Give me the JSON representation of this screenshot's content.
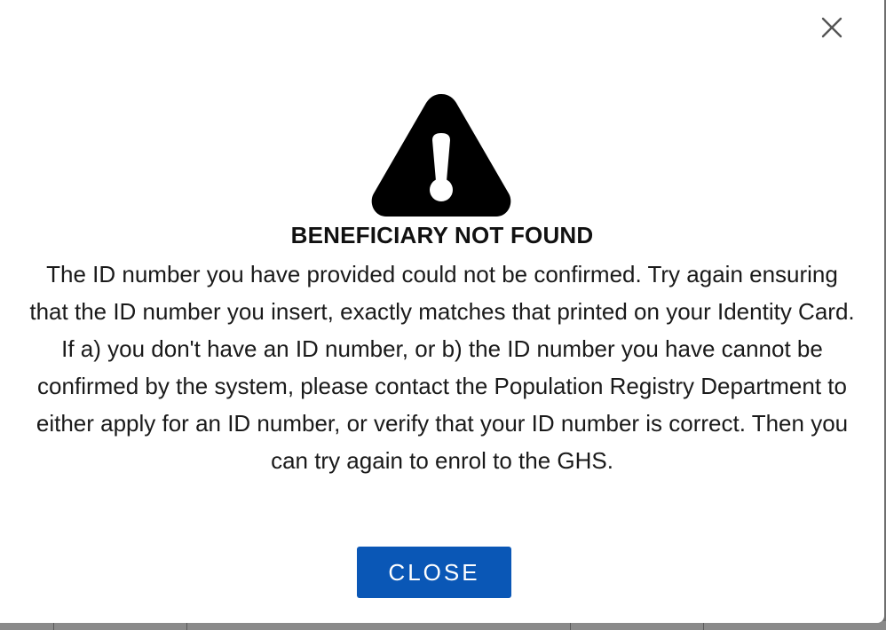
{
  "dialog": {
    "title": "BENEFICIARY NOT FOUND",
    "message": "The ID number you have provided could not be confirmed. Try again ensuring that the ID number you insert, exactly matches that printed on your Identity Card. If a) you don't have an ID number, or b) the ID number you have cannot be confirmed by the system, please contact the Population Registry Department to either apply for an ID number, or verify that your ID number is correct. Then you can try again to enrol to the GHS.",
    "close_button_label": "CLOSE",
    "icons": {
      "dismiss": "close-icon",
      "alert": "warning-triangle-icon"
    }
  },
  "colors": {
    "button_bg": "#0a57b6",
    "button_text": "#ffffff",
    "overlay": "#6f6f6f"
  }
}
